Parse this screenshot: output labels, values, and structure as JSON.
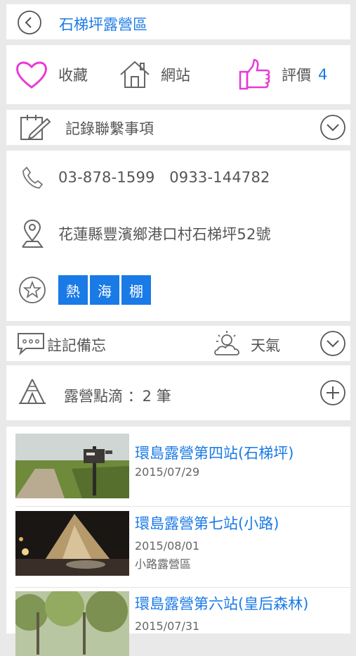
{
  "header": {
    "title": "石梯坪露營區",
    "back_icon": "back-arrow-circle"
  },
  "actions": {
    "favorite_label": "收藏",
    "website_label": "網站",
    "rating_label": "評價",
    "rating_count": "4",
    "heart_color": "#e83ad6",
    "thumb_color": "#e83ad6"
  },
  "record": {
    "label": "記錄聯繫事項"
  },
  "info": {
    "phone": "03-878-1599   0933-144782",
    "address": "花蓮縣豐濱鄉港口村石梯坪52號",
    "tags": [
      "熱",
      "海",
      "棚"
    ]
  },
  "notes": {
    "memo_label": "註記備忘",
    "weather_label": "天氣"
  },
  "drops": {
    "label": "露營點滴 ：2 筆"
  },
  "entries": [
    {
      "title": "環島露營第四站(石梯坪)",
      "date": "2015/07/29",
      "sub": ""
    },
    {
      "title": "環島露營第七站(小路)",
      "date": "2015/08/01",
      "sub": "小路露營區"
    },
    {
      "title": "環島露營第六站(皇后森林)",
      "date": "2015/07/31",
      "sub": ""
    }
  ],
  "colors": {
    "accent": "#1a7ae6",
    "background": "#e9e9e9"
  }
}
